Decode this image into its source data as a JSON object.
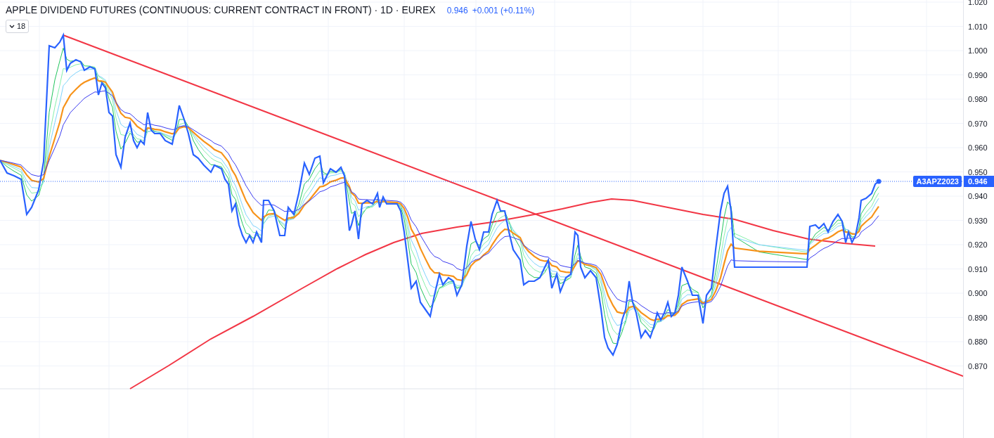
{
  "legend": {
    "title": "APPLE DIVIDEND FUTURES (CONTINUOUS: CURRENT CONTRACT IN FRONT) · 1D · EUREX",
    "price": "0.946",
    "change": "+0.001 (+0.11%)",
    "indicator_count": "18"
  },
  "y_axis": {
    "labels": [
      "1.020",
      "1.010",
      "1.000",
      "0.990",
      "0.980",
      "0.970",
      "0.960",
      "0.950",
      "0.940",
      "0.930",
      "0.920",
      "0.910",
      "0.900",
      "0.890",
      "0.880",
      "0.870"
    ]
  },
  "last_price": {
    "symbol": "A3APZ2023",
    "price": "0.946"
  }
}
